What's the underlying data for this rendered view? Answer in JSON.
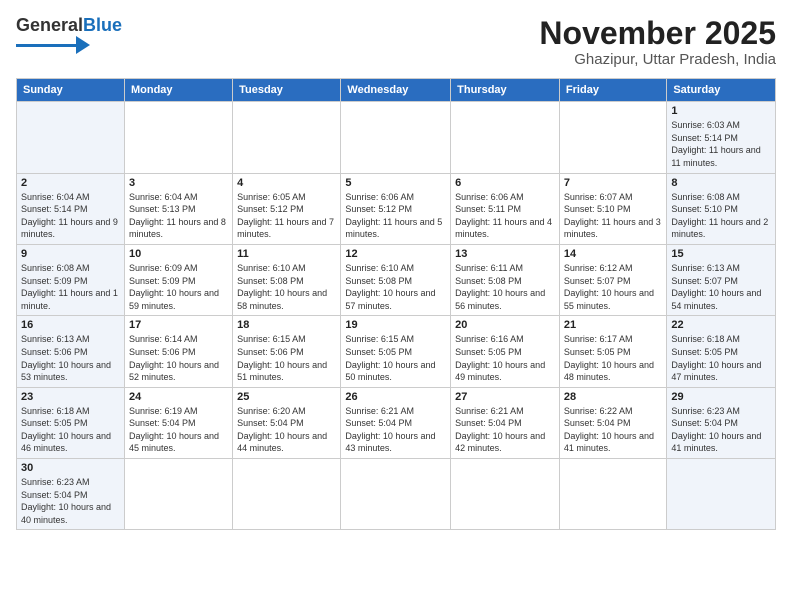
{
  "logo": {
    "text_general": "General",
    "text_blue": "Blue"
  },
  "header": {
    "month": "November 2025",
    "location": "Ghazipur, Uttar Pradesh, India"
  },
  "weekdays": [
    "Sunday",
    "Monday",
    "Tuesday",
    "Wednesday",
    "Thursday",
    "Friday",
    "Saturday"
  ],
  "weeks": [
    [
      {
        "day": "",
        "info": ""
      },
      {
        "day": "",
        "info": ""
      },
      {
        "day": "",
        "info": ""
      },
      {
        "day": "",
        "info": ""
      },
      {
        "day": "",
        "info": ""
      },
      {
        "day": "",
        "info": ""
      },
      {
        "day": "1",
        "info": "Sunrise: 6:03 AM\nSunset: 5:14 PM\nDaylight: 11 hours and 11 minutes."
      }
    ],
    [
      {
        "day": "2",
        "info": "Sunrise: 6:04 AM\nSunset: 5:14 PM\nDaylight: 11 hours and 9 minutes."
      },
      {
        "day": "3",
        "info": "Sunrise: 6:04 AM\nSunset: 5:13 PM\nDaylight: 11 hours and 8 minutes."
      },
      {
        "day": "4",
        "info": "Sunrise: 6:05 AM\nSunset: 5:12 PM\nDaylight: 11 hours and 7 minutes."
      },
      {
        "day": "5",
        "info": "Sunrise: 6:06 AM\nSunset: 5:12 PM\nDaylight: 11 hours and 5 minutes."
      },
      {
        "day": "6",
        "info": "Sunrise: 6:06 AM\nSunset: 5:11 PM\nDaylight: 11 hours and 4 minutes."
      },
      {
        "day": "7",
        "info": "Sunrise: 6:07 AM\nSunset: 5:10 PM\nDaylight: 11 hours and 3 minutes."
      },
      {
        "day": "8",
        "info": "Sunrise: 6:08 AM\nSunset: 5:10 PM\nDaylight: 11 hours and 2 minutes."
      }
    ],
    [
      {
        "day": "9",
        "info": "Sunrise: 6:08 AM\nSunset: 5:09 PM\nDaylight: 11 hours and 1 minute."
      },
      {
        "day": "10",
        "info": "Sunrise: 6:09 AM\nSunset: 5:09 PM\nDaylight: 10 hours and 59 minutes."
      },
      {
        "day": "11",
        "info": "Sunrise: 6:10 AM\nSunset: 5:08 PM\nDaylight: 10 hours and 58 minutes."
      },
      {
        "day": "12",
        "info": "Sunrise: 6:10 AM\nSunset: 5:08 PM\nDaylight: 10 hours and 57 minutes."
      },
      {
        "day": "13",
        "info": "Sunrise: 6:11 AM\nSunset: 5:08 PM\nDaylight: 10 hours and 56 minutes."
      },
      {
        "day": "14",
        "info": "Sunrise: 6:12 AM\nSunset: 5:07 PM\nDaylight: 10 hours and 55 minutes."
      },
      {
        "day": "15",
        "info": "Sunrise: 6:13 AM\nSunset: 5:07 PM\nDaylight: 10 hours and 54 minutes."
      }
    ],
    [
      {
        "day": "16",
        "info": "Sunrise: 6:13 AM\nSunset: 5:06 PM\nDaylight: 10 hours and 53 minutes."
      },
      {
        "day": "17",
        "info": "Sunrise: 6:14 AM\nSunset: 5:06 PM\nDaylight: 10 hours and 52 minutes."
      },
      {
        "day": "18",
        "info": "Sunrise: 6:15 AM\nSunset: 5:06 PM\nDaylight: 10 hours and 51 minutes."
      },
      {
        "day": "19",
        "info": "Sunrise: 6:15 AM\nSunset: 5:05 PM\nDaylight: 10 hours and 50 minutes."
      },
      {
        "day": "20",
        "info": "Sunrise: 6:16 AM\nSunset: 5:05 PM\nDaylight: 10 hours and 49 minutes."
      },
      {
        "day": "21",
        "info": "Sunrise: 6:17 AM\nSunset: 5:05 PM\nDaylight: 10 hours and 48 minutes."
      },
      {
        "day": "22",
        "info": "Sunrise: 6:18 AM\nSunset: 5:05 PM\nDaylight: 10 hours and 47 minutes."
      }
    ],
    [
      {
        "day": "23",
        "info": "Sunrise: 6:18 AM\nSunset: 5:05 PM\nDaylight: 10 hours and 46 minutes."
      },
      {
        "day": "24",
        "info": "Sunrise: 6:19 AM\nSunset: 5:04 PM\nDaylight: 10 hours and 45 minutes."
      },
      {
        "day": "25",
        "info": "Sunrise: 6:20 AM\nSunset: 5:04 PM\nDaylight: 10 hours and 44 minutes."
      },
      {
        "day": "26",
        "info": "Sunrise: 6:21 AM\nSunset: 5:04 PM\nDaylight: 10 hours and 43 minutes."
      },
      {
        "day": "27",
        "info": "Sunrise: 6:21 AM\nSunset: 5:04 PM\nDaylight: 10 hours and 42 minutes."
      },
      {
        "day": "28",
        "info": "Sunrise: 6:22 AM\nSunset: 5:04 PM\nDaylight: 10 hours and 41 minutes."
      },
      {
        "day": "29",
        "info": "Sunrise: 6:23 AM\nSunset: 5:04 PM\nDaylight: 10 hours and 41 minutes."
      }
    ],
    [
      {
        "day": "30",
        "info": "Sunrise: 6:23 AM\nSunset: 5:04 PM\nDaylight: 10 hours and 40 minutes."
      },
      {
        "day": "",
        "info": ""
      },
      {
        "day": "",
        "info": ""
      },
      {
        "day": "",
        "info": ""
      },
      {
        "day": "",
        "info": ""
      },
      {
        "day": "",
        "info": ""
      },
      {
        "day": "",
        "info": ""
      }
    ]
  ]
}
